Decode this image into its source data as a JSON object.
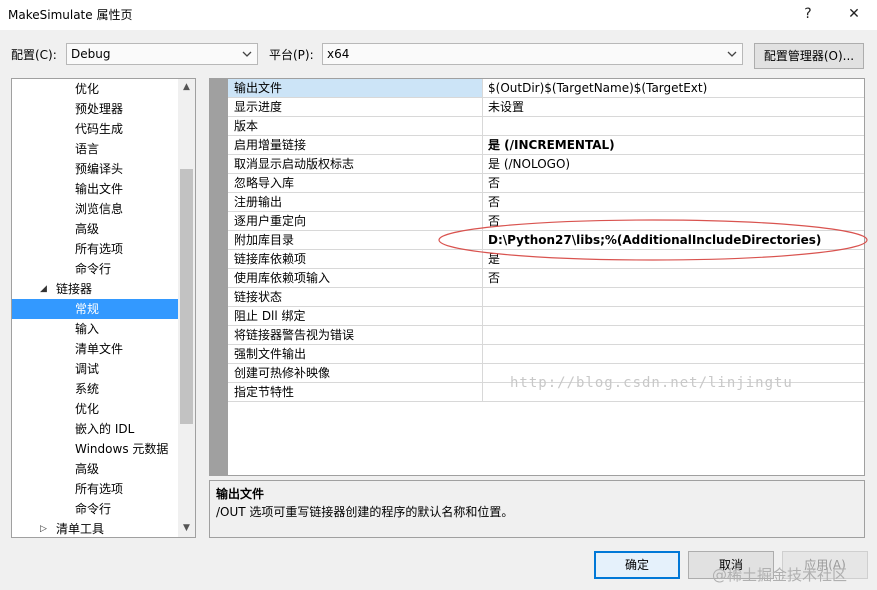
{
  "window": {
    "title": "MakeSimulate 属性页",
    "help_label": "?",
    "close_label": "✕"
  },
  "toolbar": {
    "config_label": "配置(C):",
    "config_value": "Debug",
    "platform_label": "平台(P):",
    "platform_value": "x64",
    "config_manager_label": "配置管理器(O)..."
  },
  "tree": {
    "items": [
      {
        "label": "优化",
        "expander": ""
      },
      {
        "label": "预处理器",
        "expander": ""
      },
      {
        "label": "代码生成",
        "expander": ""
      },
      {
        "label": "语言",
        "expander": ""
      },
      {
        "label": "预编译头",
        "expander": ""
      },
      {
        "label": "输出文件",
        "expander": ""
      },
      {
        "label": "浏览信息",
        "expander": ""
      },
      {
        "label": "高级",
        "expander": ""
      },
      {
        "label": "所有选项",
        "expander": ""
      },
      {
        "label": "命令行",
        "expander": ""
      },
      {
        "label": "链接器",
        "expander": "◢"
      },
      {
        "label": "常规",
        "expander": ""
      },
      {
        "label": "输入",
        "expander": ""
      },
      {
        "label": "清单文件",
        "expander": ""
      },
      {
        "label": "调试",
        "expander": ""
      },
      {
        "label": "系统",
        "expander": ""
      },
      {
        "label": "优化",
        "expander": ""
      },
      {
        "label": "嵌入的 IDL",
        "expander": ""
      },
      {
        "label": "Windows 元数据",
        "expander": ""
      },
      {
        "label": "高级",
        "expander": ""
      },
      {
        "label": "所有选项",
        "expander": ""
      },
      {
        "label": "命令行",
        "expander": ""
      },
      {
        "label": "清单工具",
        "expander": "▷"
      }
    ],
    "selected_index": 11
  },
  "grid": {
    "rows": [
      {
        "name": "输出文件",
        "value": "$(OutDir)$(TargetName)$(TargetExt)",
        "bold": false
      },
      {
        "name": "显示进度",
        "value": "未设置",
        "bold": false
      },
      {
        "name": "版本",
        "value": "",
        "bold": false
      },
      {
        "name": "启用增量链接",
        "value": "是 (/INCREMENTAL)",
        "bold": true
      },
      {
        "name": "取消显示启动版权标志",
        "value": "是 (/NOLOGO)",
        "bold": false
      },
      {
        "name": "忽略导入库",
        "value": "否",
        "bold": false
      },
      {
        "name": "注册输出",
        "value": "否",
        "bold": false
      },
      {
        "name": "逐用户重定向",
        "value": "否",
        "bold": false
      },
      {
        "name": "附加库目录",
        "value": "D:\\Python27\\libs;%(AdditionalIncludeDirectories)",
        "bold": true
      },
      {
        "name": "链接库依赖项",
        "value": "是",
        "bold": false
      },
      {
        "name": "使用库依赖项输入",
        "value": "否",
        "bold": false
      },
      {
        "name": "链接状态",
        "value": "",
        "bold": false
      },
      {
        "name": "阻止 Dll 绑定",
        "value": "",
        "bold": false
      },
      {
        "name": "将链接器警告视为错误",
        "value": "",
        "bold": false
      },
      {
        "name": "强制文件输出",
        "value": "",
        "bold": false
      },
      {
        "name": "创建可热修补映像",
        "value": "",
        "bold": false
      },
      {
        "name": "指定节特性",
        "value": "",
        "bold": false
      }
    ],
    "selected_index": 0,
    "watermark": "http://blog.csdn.net/linjingtu"
  },
  "description": {
    "title": "输出文件",
    "text": "/OUT 选项可重写链接器创建的程序的默认名称和位置。"
  },
  "buttons": {
    "ok": "确定",
    "cancel": "取消",
    "apply": "应用(A)"
  },
  "corner_watermark": "@稀土掘金技术社区",
  "colors": {
    "selection": "#3399ff",
    "accent_border": "#0078d7",
    "annotation_ellipse": "#d9534f"
  }
}
